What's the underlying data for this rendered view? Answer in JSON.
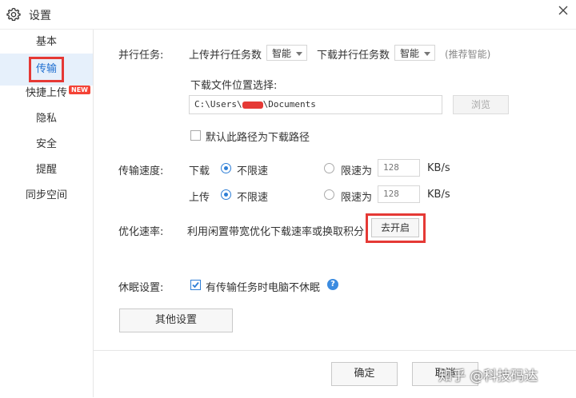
{
  "window": {
    "title": "设置",
    "settings_icon": "gear-icon",
    "close_icon": "close-icon"
  },
  "sidebar": {
    "items": [
      {
        "label": "基本"
      },
      {
        "label": "传输",
        "active": true
      },
      {
        "label": "快捷上传",
        "badge": "NEW"
      },
      {
        "label": "隐私"
      },
      {
        "label": "安全"
      },
      {
        "label": "提醒"
      },
      {
        "label": "同步空间"
      }
    ]
  },
  "parallel": {
    "label": "并行任务:",
    "upload_label": "上传并行任务数",
    "upload_value": "智能",
    "download_label": "下载并行任务数",
    "download_value": "智能",
    "hint": "(推荐智能)"
  },
  "download_location": {
    "label": "下载文件位置选择:",
    "path_prefix": "C:\\Users\\",
    "path_suffix": "\\Documents",
    "browse_button": "浏览",
    "default_checkbox": "默认此路径为下载路径",
    "default_checked": false
  },
  "speed": {
    "label": "传输速度:",
    "download": {
      "label": "下载",
      "unlimited": "不限速",
      "limit_label": "限速为",
      "limit_value": "128",
      "unit": "KB/s"
    },
    "upload": {
      "label": "上传",
      "unlimited": "不限速",
      "limit_label": "限速为",
      "limit_value": "128",
      "unit": "KB/s"
    }
  },
  "optimize": {
    "label": "优化速率:",
    "description": "利用闲置带宽优化下载速率或换取积分",
    "button": "去开启"
  },
  "sleep": {
    "label": "休眠设置:",
    "checkbox": "有传输任务时电脑不休眠",
    "checked": true,
    "help_glyph": "?"
  },
  "other_settings_button": "其他设置",
  "footer": {
    "ok": "确定",
    "cancel": "取消"
  },
  "watermark": "知乎 @科技码达",
  "colors": {
    "accent": "#2f7fd6",
    "highlight_red": "#e53935",
    "active_bg": "#e6f0fb"
  }
}
